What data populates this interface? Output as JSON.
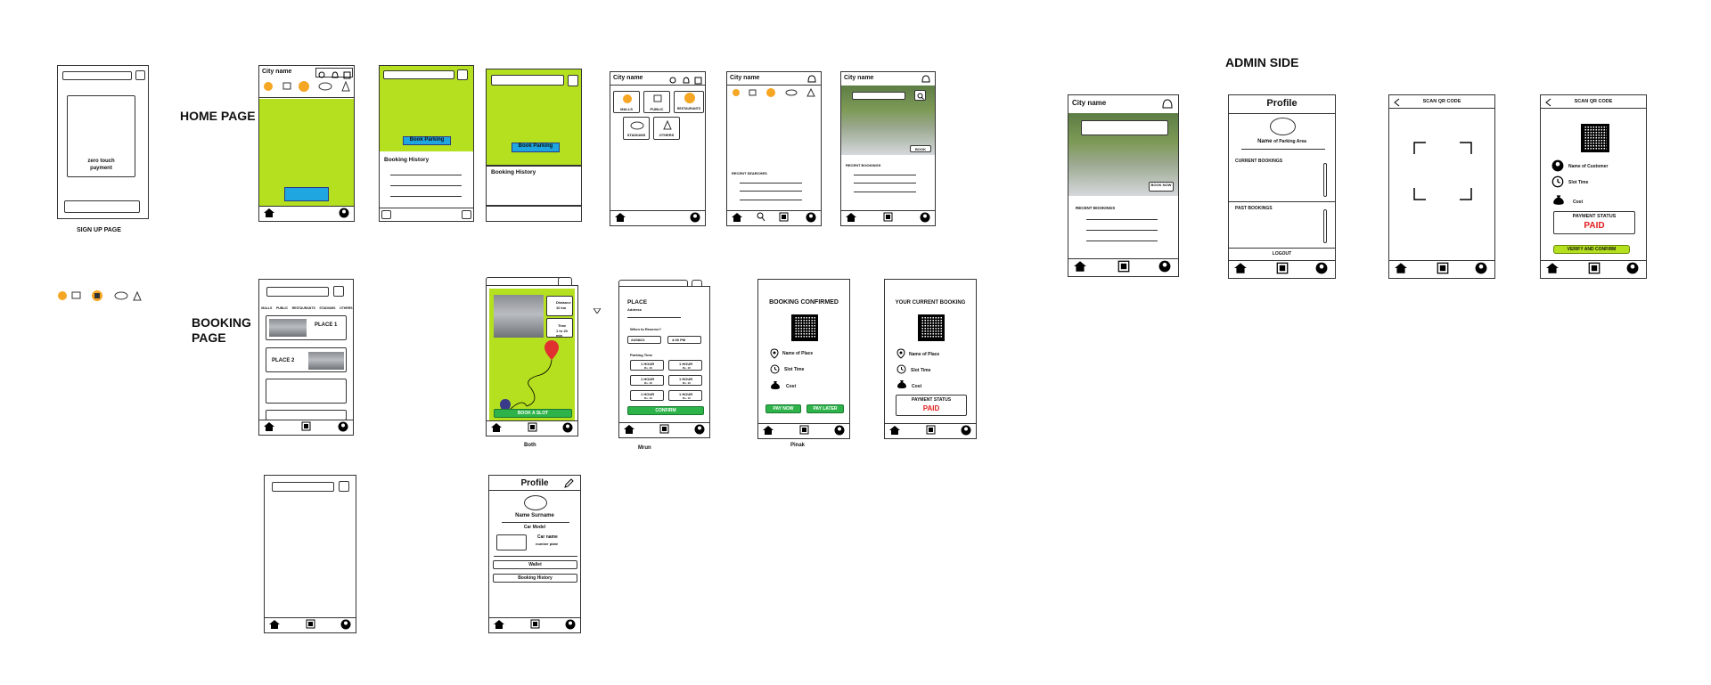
{
  "section_labels": {
    "home_page": "HOME PAGE",
    "booking_page_line1": "BOOKING",
    "booking_page_line2": "PAGE",
    "admin_side": "ADMIN SIDE",
    "sign_up_page": "SIGN UP PAGE"
  },
  "captions": {
    "both": "Both",
    "mrun": "Mrun",
    "pinak": "Pinak"
  },
  "signup": {
    "zero_touch": "zero touch",
    "payment": "payment"
  },
  "common": {
    "city_name": "City name",
    "book_parking": "Book Parking",
    "booking_history": "Booking History",
    "recent_searches": "RECENT SEARCHES",
    "recent_bookings": "RECENT BOOKINGS",
    "book": "BOOK",
    "book_now": "BOOK NOW",
    "book_a_slot": "BOOK A SLOT"
  },
  "categories": [
    "MALLS",
    "PUBLIC",
    "RESTAURANTS",
    "STADIUMS",
    "OTHERS"
  ],
  "nav": {
    "home": "HOME",
    "book": "BOOK",
    "scan_qr": "SCAN QR",
    "profile": "PROFILE"
  },
  "booking_list": {
    "place1": "PLACE 1",
    "place2": "PLACE 2"
  },
  "map_screen": {
    "distance_label": "Distance",
    "distance_value": "10 km",
    "time_label": "Time",
    "time_value": "1 hr 20 min"
  },
  "place_form": {
    "place": "PLACE",
    "address": "Address",
    "when": "When to Reserve?",
    "date": "24/08/21",
    "time": "4:30 PM",
    "parking_time": "Parking Time",
    "options": [
      "1 HOUR",
      "1 HOUR",
      "1 HOUR",
      "1 HOUR",
      "1 HOUR",
      "1 HOUR"
    ],
    "option_price": "Rs. 10",
    "confirm": "CONFIRM"
  },
  "confirmed": {
    "title": "BOOKING CONFIRMED",
    "name_of_place": "Name of Place",
    "slot_time": "Slot Time",
    "cost": "Cost",
    "pay_now": "PAY NOW",
    "pay_later": "PAY LATER"
  },
  "current": {
    "title": "YOUR CURRENT BOOKING",
    "payment_status": "PAYMENT STATUS",
    "paid": "PAID"
  },
  "profile_user": {
    "title": "Profile",
    "name": "Name Surname",
    "car_model": "Car Model",
    "car_name": "Car name",
    "number_plate": "number plate",
    "wallet": "Wallet",
    "booking_history": "Booking History"
  },
  "admin": {
    "profile_title": "Profile",
    "name_of": "Name",
    "parking_area": "of Parking Area",
    "current_bookings": "CURRENT BOOKINGS",
    "past_bookings": "PAST BOOKINGS",
    "logout": "LOGOUT",
    "scan_qr_code": "SCAN QR CODE",
    "name_of_customer": "Name of Customer",
    "slot_time": "Slot Time",
    "cost": "Cost",
    "payment_status": "PAYMENT STATUS",
    "paid": "PAID",
    "verify": "VERIFY AND CONFIRM"
  },
  "colors": {
    "lime": "#b4e01f",
    "blue": "#1fa6e0",
    "green": "#2db34a",
    "red": "#e02020",
    "orange": "#f5a623"
  }
}
